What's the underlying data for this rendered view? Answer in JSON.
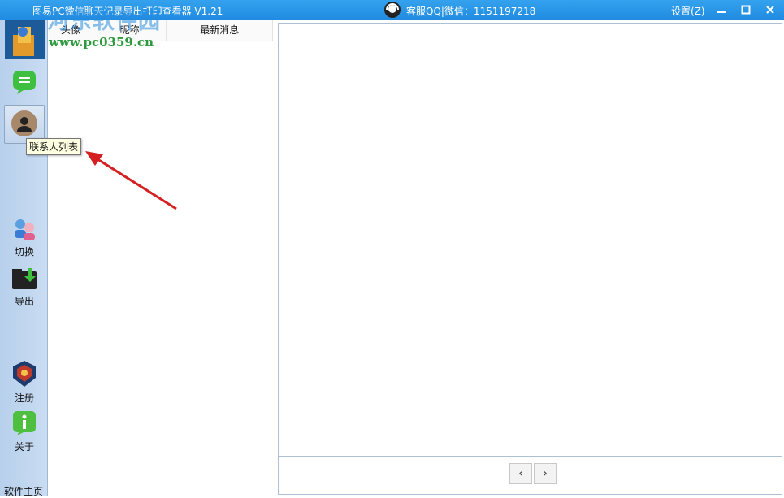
{
  "titlebar": {
    "app_title": "图易PC微信聊天记录导出打印查看器 V1.21",
    "service_label": "客服QQ|微信：1151197218",
    "settings_label": "设置(Z)"
  },
  "sidebar": {
    "switch_label": "切换",
    "export_label": "导出",
    "register_label": "注册",
    "about_label": "关于",
    "home_label": "软件主页"
  },
  "tooltip": {
    "text": "联系人列表"
  },
  "contact_list": {
    "columns": [
      "头像",
      "昵称",
      "最新消息"
    ]
  },
  "pager": {
    "prev": "‹",
    "next": "›"
  },
  "watermark": {
    "site_name": "河东软件园",
    "url": "www.pc0359.cn"
  },
  "colors": {
    "titlebar": "#2a95e8",
    "sidebar": "#c0d6ef",
    "arrow": "#d42020"
  }
}
